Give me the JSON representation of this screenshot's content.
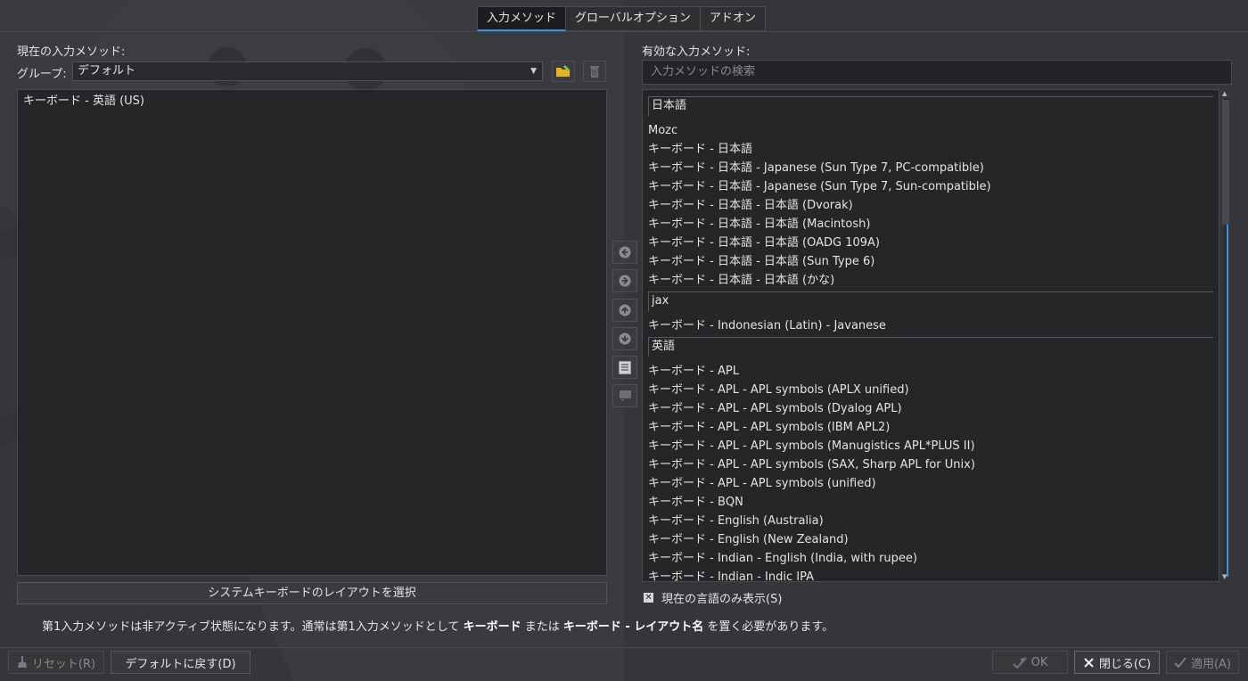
{
  "tabs": [
    {
      "label": "入力メソッド",
      "active": true
    },
    {
      "label": "グローバルオプション",
      "active": false
    },
    {
      "label": "アドオン",
      "active": false
    }
  ],
  "left": {
    "title": "現在の入力メソッド:",
    "group_label": "グループ:",
    "group_value": "デフォルト",
    "items": [
      "キーボード - 英語 (US)"
    ],
    "select_layout_button": "システムキーボードのレイアウトを選択"
  },
  "right": {
    "title": "有効な入力メソッド:",
    "search_placeholder": "入力メソッドの検索",
    "groups": [
      {
        "name": "日本語",
        "items": [
          "Mozc",
          "キーボード - 日本語",
          "キーボード - 日本語 - Japanese (Sun Type 7, PC-compatible)",
          "キーボード - 日本語 - Japanese (Sun Type 7, Sun-compatible)",
          "キーボード - 日本語 - 日本語 (Dvorak)",
          "キーボード - 日本語 - 日本語 (Macintosh)",
          "キーボード - 日本語 - 日本語 (OADG 109A)",
          "キーボード - 日本語 - 日本語 (Sun Type 6)",
          "キーボード - 日本語 - 日本語 (かな)"
        ]
      },
      {
        "name": "jax",
        "items": [
          "キーボード - Indonesian (Latin) - Javanese"
        ]
      },
      {
        "name": "英語",
        "items": [
          "キーボード - APL",
          "キーボード - APL - APL symbols (APLX unified)",
          "キーボード - APL - APL symbols (Dyalog APL)",
          "キーボード - APL - APL symbols (IBM APL2)",
          "キーボード - APL - APL symbols (Manugistics APL*PLUS II)",
          "キーボード - APL - APL symbols (SAX, Sharp APL for Unix)",
          "キーボード - APL - APL symbols (unified)",
          "キーボード - BQN",
          "キーボード - English (Australia)",
          "キーボード - English (New Zealand)",
          "キーボード - Indian - English (India, with rupee)",
          "キーボード - Indian - Indic IPA"
        ]
      }
    ],
    "current_language_only_label": "現在の言語のみ表示(S)",
    "current_language_only_checked": true
  },
  "note": {
    "prefix": "第1入力メソッドは非アクティブ状態になります。通常は第1入力メソッドとして ",
    "bold1": "キーボード",
    "middle": " または ",
    "bold2": "キーボード - レイアウト名",
    "suffix": " を置く必要があります。"
  },
  "footer": {
    "reset": "リセット(R)",
    "defaults": "デフォルトに戻す(D)",
    "ok": "OK",
    "close": "閉じる(C)",
    "apply": "適用(A)"
  },
  "icons": {
    "add_group": "folder-add-icon",
    "delete_group": "trash-icon",
    "left": "arrow-left-icon",
    "right": "arrow-right-icon",
    "up": "arrow-up-icon",
    "down": "arrow-down-icon",
    "configure": "configure-icon",
    "keyboard_layout": "keyboard-layout-icon"
  },
  "colors": {
    "accent": "#3d8ee6",
    "background": "#35363a",
    "list_background": "#262628"
  }
}
